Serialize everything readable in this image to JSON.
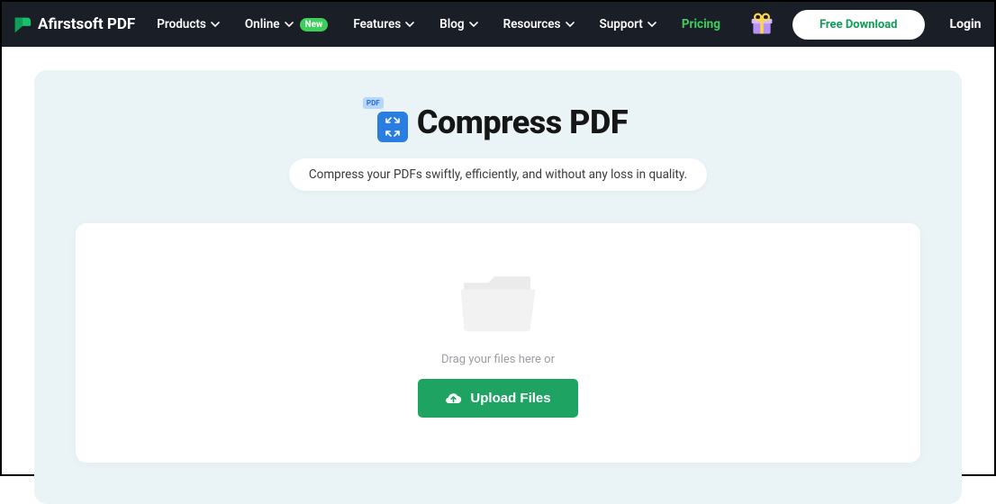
{
  "brand": "Afirstsoft PDF",
  "nav": {
    "products": "Products",
    "online": "Online",
    "online_badge": "New",
    "features": "Features",
    "blog": "Blog",
    "resources": "Resources",
    "support": "Support",
    "pricing": "Pricing"
  },
  "cta": {
    "free_download": "Free Download",
    "login": "Login"
  },
  "tool": {
    "pdf_tag": "PDF",
    "title": "Compress PDF",
    "subtitle": "Compress your PDFs swiftly, efficiently, and without any loss in quality."
  },
  "dropzone": {
    "drag_text": "Drag your files here or",
    "upload_label": "Upload Files"
  }
}
